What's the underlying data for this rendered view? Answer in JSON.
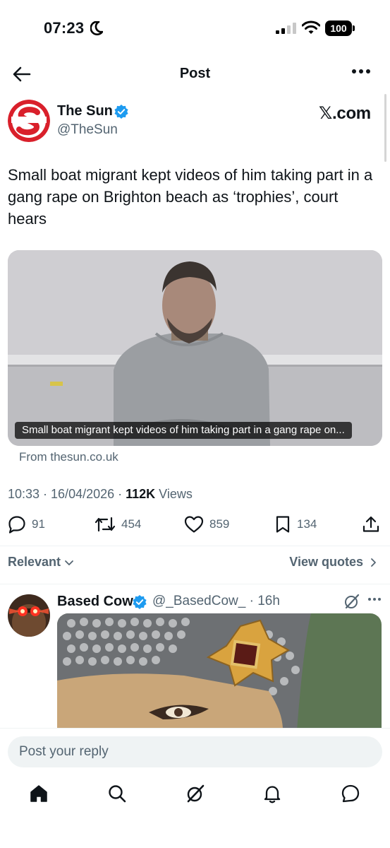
{
  "status_bar": {
    "time": "07:23",
    "battery": "100"
  },
  "header": {
    "title": "Post"
  },
  "post": {
    "author_name": "The Sun",
    "author_handle": "@TheSun",
    "source_logo": "𝕏.com",
    "text": "Small boat migrant kept videos of him taking part in a gang rape on Brighton beach as ‘trophies’, court hears",
    "card_caption": "Small boat migrant kept videos of him taking part in a gang rape on...",
    "link_source": "From thesun.co.uk",
    "timestamp": "10:33 · 16/04/2026 · ",
    "views_count": "112K",
    "views_label": " Views",
    "replies": "91",
    "reposts": "454",
    "likes": "859",
    "bookmarks": "134"
  },
  "sort": {
    "relevant_label": "Relevant",
    "view_quotes_label": "View quotes"
  },
  "reply": {
    "name": "Based Cow",
    "handle_time": "@_BasedCow_ · 16h"
  },
  "composer": {
    "placeholder": "Post your reply"
  },
  "icons": [
    "moon-icon",
    "signal-icon",
    "wifi-icon",
    "back-icon",
    "more-icon",
    "verified-icon",
    "reply-icon",
    "repost-icon",
    "like-icon",
    "bookmark-icon",
    "share-icon",
    "chevron-down-icon",
    "chevron-right-icon",
    "grok-icon",
    "home-icon",
    "search-icon",
    "notifications-icon",
    "messages-icon"
  ],
  "colors": {
    "verified": "#1d9bf0",
    "secondary_text": "#536471",
    "sun_red": "#d9202b"
  }
}
